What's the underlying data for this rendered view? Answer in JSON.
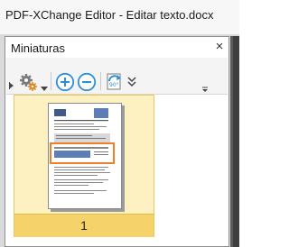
{
  "window": {
    "title": "PDF-XChange Editor - Editar texto.docx"
  },
  "panel": {
    "title": "Miniaturas",
    "close_glyph": "×"
  },
  "toolbar": {
    "icons": [
      "settings-gears-icon",
      "dropdown-arrow-icon",
      "zoom-in-icon",
      "zoom-out-icon",
      "rotate-90-icon",
      "more-chevron-icon",
      "collapse-icon"
    ]
  },
  "thumbnails": [
    {
      "page_number": "1",
      "selected": true
    }
  ],
  "colors": {
    "selection_fill": "#fdf1c2",
    "selection_label": "#f5d36a",
    "zoom_icon_blue": "#2e8fd6",
    "highlight_orange": "#f07f2a"
  }
}
